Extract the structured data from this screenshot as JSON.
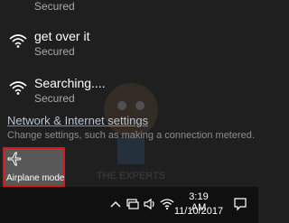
{
  "networks": [
    {
      "name": "",
      "status": "Secured",
      "icon": "wifi-icon"
    },
    {
      "name": "get over it",
      "status": "Secured",
      "icon": "wifi-icon"
    },
    {
      "name": "Searching....",
      "status": "Secured",
      "icon": "wifi-icon"
    }
  ],
  "settings": {
    "link": "Network & Internet settings",
    "description": "Change settings, such as making a connection metered."
  },
  "quick_actions": {
    "airplane_mode_label": "Airplane mode",
    "airplane_icon": "airplane-icon"
  },
  "taskbar": {
    "time": "3:19 AM",
    "date": "11/10/2017",
    "icons": [
      "chevron-up-icon",
      "network-icon",
      "volume-icon",
      "wifi-tray-icon",
      "action-center-icon"
    ]
  },
  "watermark": {
    "text": "THE EXPERTS"
  },
  "colors": {
    "background": "#1f1f1f",
    "taskbar": "#101010",
    "tile": "#585858",
    "highlight": "#d11a1a"
  }
}
